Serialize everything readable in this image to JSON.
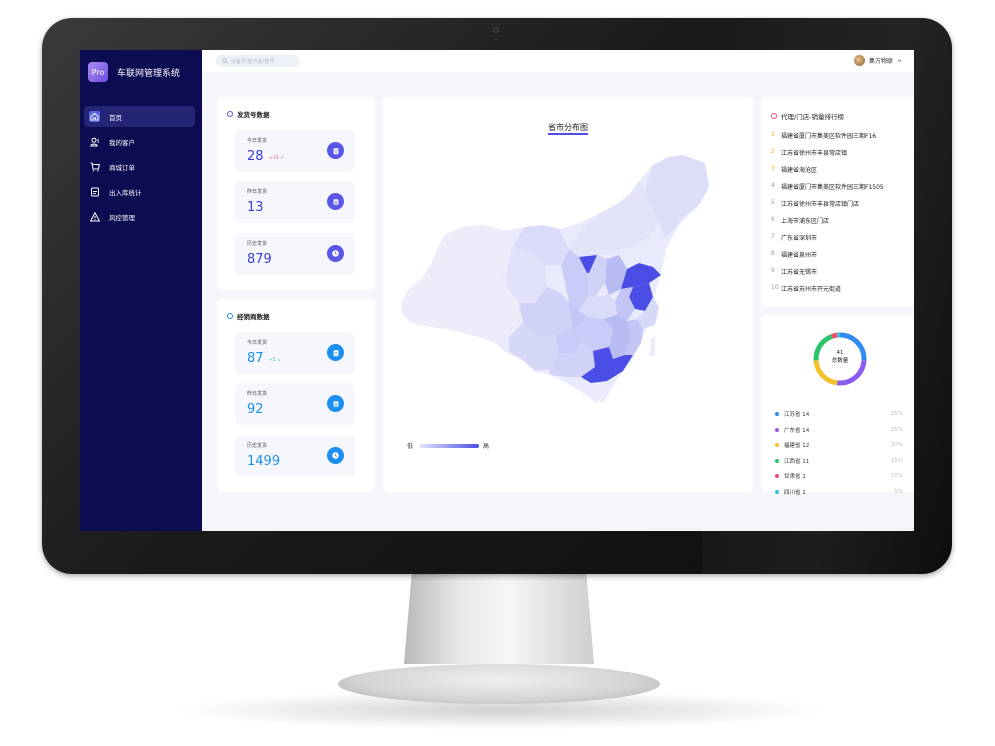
{
  "app": {
    "logo_text": "Pro",
    "title": "车联网管理系统"
  },
  "sidebar": {
    "items": [
      {
        "label": "首页",
        "icon": "home-icon",
        "active": true
      },
      {
        "label": "我的客户",
        "icon": "users-icon",
        "active": false
      },
      {
        "label": "商城订单",
        "icon": "cart-icon",
        "active": false
      },
      {
        "label": "出入库统计",
        "icon": "document-icon",
        "active": false
      },
      {
        "label": "风控管理",
        "icon": "warning-icon",
        "active": false
      }
    ]
  },
  "header": {
    "search_placeholder": "设备号/客户名/账号",
    "user_name": "集方物联"
  },
  "shipping": {
    "title": "发货号数据",
    "today_label": "今日发货",
    "today_value": "28",
    "today_delta": "+15",
    "yesterday_label": "昨日发货",
    "yesterday_value": "13",
    "history_label": "历史发货",
    "history_value": "879"
  },
  "dealer": {
    "title": "经销商数据",
    "today_label": "今日发货",
    "today_value": "87",
    "today_delta": "+5",
    "yesterday_label": "昨日发货",
    "yesterday_value": "92",
    "history_label": "历史发货",
    "history_value": "1499"
  },
  "map": {
    "title": "省市分布图",
    "legend_low": "低",
    "legend_high": "高",
    "low_color": "#e6e7fb",
    "high_color": "#4a4de6"
  },
  "ranking": {
    "title": "代理/门店-销量排行榜",
    "items": [
      {
        "rank": "1",
        "name": "福建省厦门市集美区软件园三期F16"
      },
      {
        "rank": "2",
        "name": "江苏省徐州市丰县常店镇"
      },
      {
        "rank": "3",
        "name": "福建省海沧区"
      },
      {
        "rank": "4",
        "name": "福建省厦门市集美区软件园三期F1505"
      },
      {
        "rank": "5",
        "name": "江苏省徐州市丰县常店镇门店"
      },
      {
        "rank": "6",
        "name": "上海市浦东区门店"
      },
      {
        "rank": "7",
        "name": "广东省深圳市"
      },
      {
        "rank": "8",
        "name": "福建省泉州市"
      },
      {
        "rank": "9",
        "name": "江苏省无锡市"
      },
      {
        "rank": "10",
        "name": "江苏省苏州市开元街道"
      }
    ]
  },
  "donut": {
    "total": "41",
    "total_label": "总数量",
    "items": [
      {
        "label": "江苏省 14",
        "pct": "25%",
        "value": 14,
        "color": "#2f8cf0"
      },
      {
        "label": "广东省 14",
        "pct": "25%",
        "value": 14,
        "color": "#8a5cf0"
      },
      {
        "label": "福建省 12",
        "pct": "20%",
        "value": 12,
        "color": "#f5c22d"
      },
      {
        "label": "江西省 11",
        "pct": "15%",
        "value": 11,
        "color": "#2cc56b"
      },
      {
        "label": "甘肃省 2",
        "pct": "10%",
        "value": 2,
        "color": "#f0506e"
      },
      {
        "label": "四川省 1",
        "pct": "5%",
        "value": 1,
        "color": "#2fc3d8"
      }
    ]
  },
  "colors": {
    "sidebar_bg": "#0b0c52",
    "accent": "#4a4de6",
    "accent_blue": "#1d8ff0",
    "up_red": "#f0506e",
    "up_green": "#2cc56b"
  }
}
